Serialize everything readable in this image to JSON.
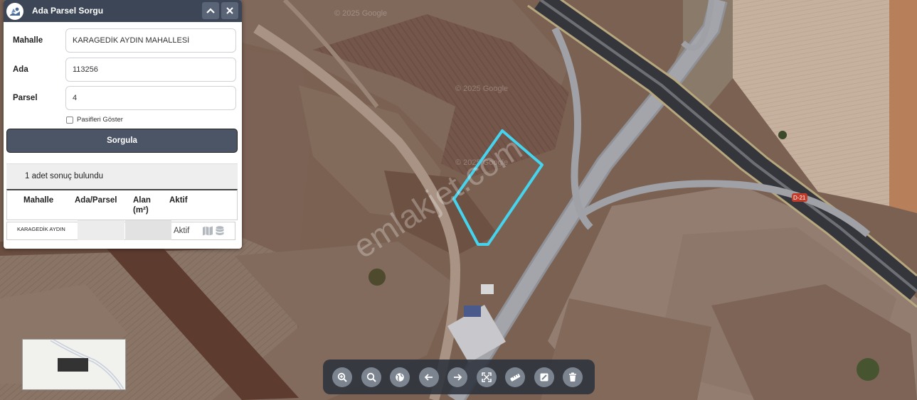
{
  "panel": {
    "title": "Ada Parsel Sorgu",
    "logo_icon": "map-parcel-icon",
    "collapse_icon": "chevron-up-icon",
    "close_icon": "close-icon",
    "fields": {
      "mahalle_label": "Mahalle",
      "mahalle_value": "KARAGEDİK AYDIN MAHALLESİ",
      "ada_label": "Ada",
      "ada_value": "113256",
      "parsel_label": "Parsel",
      "parsel_value": "4"
    },
    "pasifleri_label": "Pasifleri Göster",
    "pasifleri_checked": false,
    "submit_label": "Sorgula",
    "result_text": "1 adet sonuç bulundu",
    "table": {
      "headers": [
        "Mahalle",
        "Ada/Parsel",
        "Alan",
        "(m²)",
        "Aktif"
      ],
      "row": {
        "mahalle": "KARAGEDİK AYDIN",
        "aktif": "Aktif",
        "icons": [
          "map-icon",
          "database-icon"
        ]
      }
    }
  },
  "map": {
    "watermark": "emlakjet.com",
    "google_watermark": "© 2025 Google",
    "road_sign": "D-21",
    "parcel_outline_color": "#46d3ee"
  },
  "toolbar": {
    "buttons": [
      "zoom-in-icon",
      "zoom-out-icon",
      "globe-icon",
      "arrow-left-icon",
      "arrow-right-icon",
      "fullscreen-icon",
      "ruler-icon",
      "draw-icon",
      "trash-icon"
    ]
  },
  "colors": {
    "panel_header": "#3c4656",
    "submit_button": "#4b5566",
    "toolbar": "#2c323c",
    "parcel_outline": "#46d3ee"
  }
}
